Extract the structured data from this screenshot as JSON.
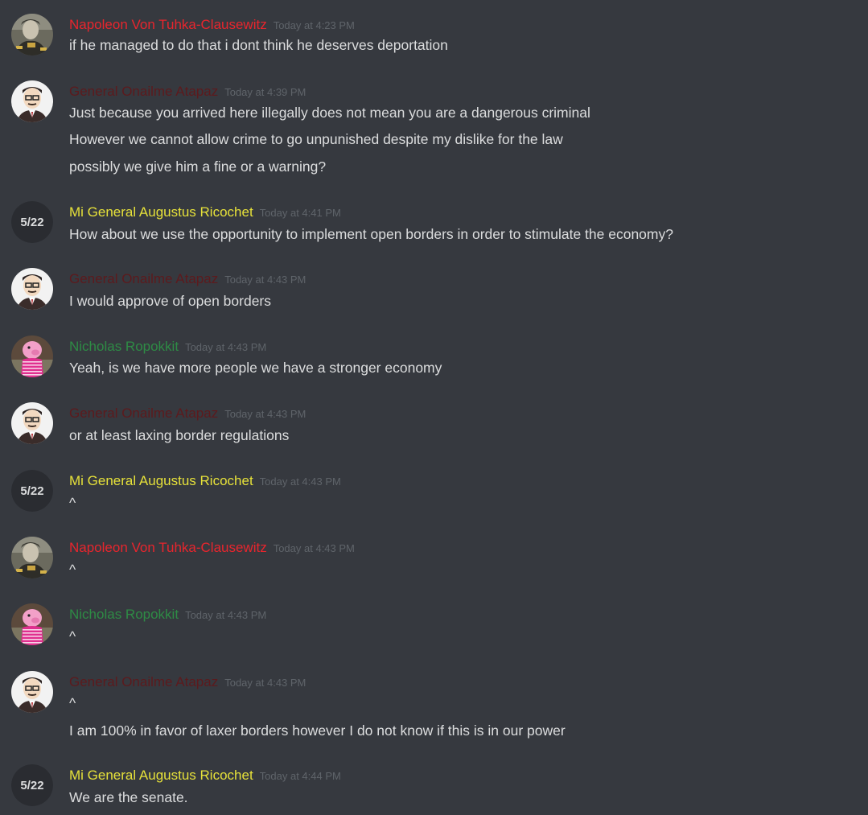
{
  "users": {
    "napoleon": {
      "name": "Napoleon Von Tuhka-Clausewitz",
      "color": "#e8252d"
    },
    "onailme": {
      "name": "General Onailme Atapaz",
      "color": "#5c1a1d"
    },
    "augustus": {
      "name": "Mi General Augustus Ricochet",
      "color": "#e6e13a",
      "avatar_text": "5/22"
    },
    "nicholas": {
      "name": "Nicholas Ropokkit",
      "color": "#2e8b45"
    }
  },
  "messages": [
    {
      "user": "napoleon",
      "timestamp": "Today at 4:23 PM",
      "lines": [
        "if he managed to do that i dont think he deserves deportation"
      ]
    },
    {
      "user": "onailme",
      "timestamp": "Today at 4:39 PM",
      "lines": [
        "Just because you arrived here illegally does not mean you are a dangerous criminal",
        "However we cannot allow crime to go unpunished despite my dislike for the law",
        "possibly we give him a fine or a warning?"
      ]
    },
    {
      "user": "augustus",
      "timestamp": "Today at 4:41 PM",
      "lines": [
        "How about we use the opportunity to implement open borders in order to stimulate the economy?"
      ]
    },
    {
      "user": "onailme",
      "timestamp": "Today at 4:43 PM",
      "lines": [
        "I would approve of open borders"
      ]
    },
    {
      "user": "nicholas",
      "timestamp": "Today at 4:43 PM",
      "lines": [
        "Yeah, is we have more people we have a stronger economy"
      ]
    },
    {
      "user": "onailme",
      "timestamp": "Today at 4:43 PM",
      "lines": [
        "or at least laxing border regulations"
      ]
    },
    {
      "user": "augustus",
      "timestamp": "Today at 4:43 PM",
      "lines": [
        "^"
      ]
    },
    {
      "user": "napoleon",
      "timestamp": "Today at 4:43 PM",
      "lines": [
        "^"
      ]
    },
    {
      "user": "nicholas",
      "timestamp": "Today at 4:43 PM",
      "lines": [
        "^"
      ]
    },
    {
      "user": "onailme",
      "timestamp": "Today at 4:43 PM",
      "lines": [
        "^",
        "I am 100% in favor of laxer borders however I do not know if this is in our power"
      ]
    },
    {
      "user": "augustus",
      "timestamp": "Today at 4:44 PM",
      "lines": [
        "We are the senate."
      ]
    }
  ]
}
